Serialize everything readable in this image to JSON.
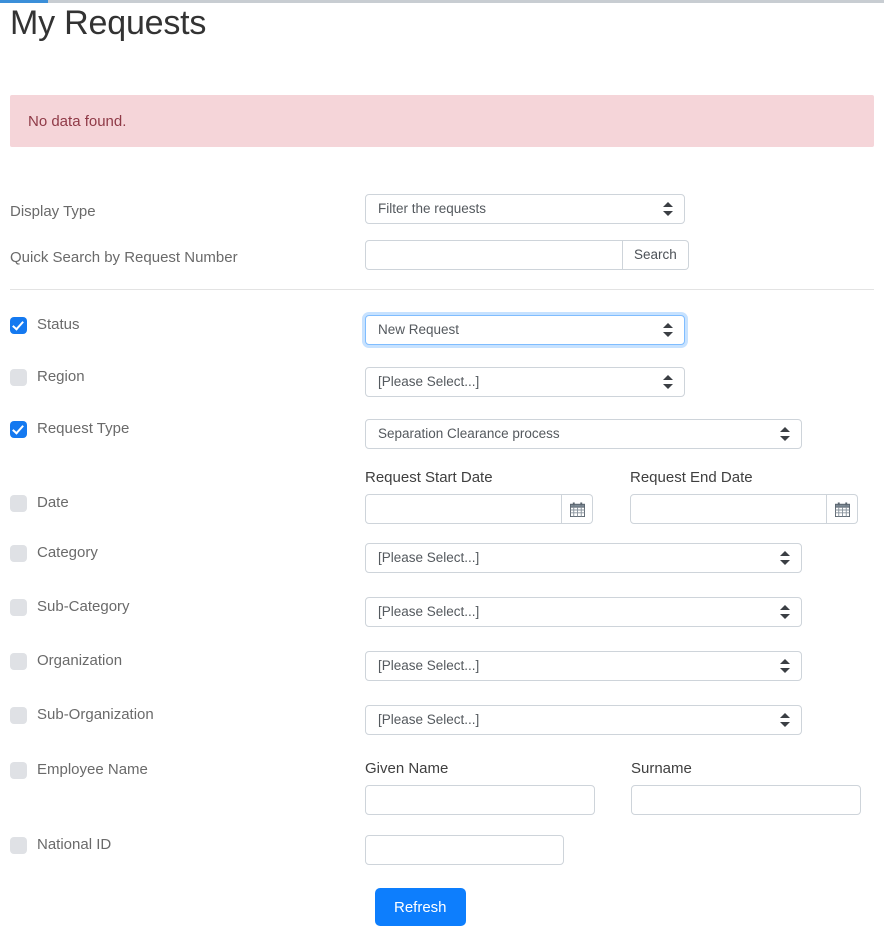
{
  "page": {
    "title": "My Requests",
    "progress_indicator": "loading-bar"
  },
  "alert": {
    "message": "No data found.",
    "background": "#f5d5d9",
    "text_color": "#8f3a47"
  },
  "top_filters": [
    {
      "label": "Display Type",
      "control": "select",
      "value": "Filter the requests"
    },
    {
      "label": "Quick Search by Request Number",
      "control": "input-group",
      "value": "",
      "placeholder": "",
      "button_label": "Search"
    }
  ],
  "filters": {
    "status": {
      "label": "Status",
      "checked": true,
      "value": "New Request",
      "focused": true
    },
    "region": {
      "label": "Region",
      "checked": false,
      "value": "[Please Select...]"
    },
    "request_type": {
      "label": "Request Type",
      "checked": true,
      "value": "Separation Clearance process"
    },
    "date": {
      "label": "Date",
      "checked": false,
      "start": {
        "label": "Request Start Date",
        "value": "",
        "icon": "calendar-icon"
      },
      "end": {
        "label": "Request End Date",
        "value": "",
        "icon": "calendar-icon"
      }
    },
    "category": {
      "label": "Category",
      "checked": false,
      "value": "[Please Select...]"
    },
    "sub_category": {
      "label": "Sub-Category",
      "checked": false,
      "value": "[Please Select...]"
    },
    "organization": {
      "label": "Organization",
      "checked": false,
      "value": "[Please Select...]"
    },
    "sub_organization": {
      "label": "Sub-Organization",
      "checked": false,
      "value": "[Please Select...]"
    },
    "employee_name": {
      "label": "Employee Name",
      "checked": false,
      "given": {
        "label": "Given Name",
        "value": ""
      },
      "surname": {
        "label": "Surname",
        "value": ""
      }
    },
    "national_id": {
      "label": "National ID",
      "checked": false,
      "value": ""
    }
  },
  "actions": {
    "refresh_label": "Refresh"
  },
  "colors": {
    "accent": "#0d7efd",
    "checkbox_on": "#1479f0",
    "checkbox_off": "#dfe1e5",
    "border": "#ced4da",
    "alert_bg": "#f5d5d9"
  }
}
